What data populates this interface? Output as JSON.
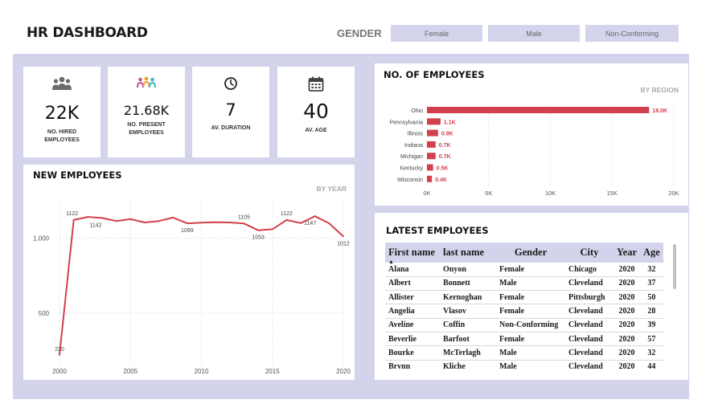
{
  "header": {
    "title": "HR DASHBOARD",
    "gender_label": "GENDER",
    "slicers": [
      "Female",
      "Male",
      "Non-Conforming"
    ]
  },
  "kpis": [
    {
      "icon": "people-group-icon",
      "value": "22K",
      "label_line1": "NO. HIRED",
      "label_line2": "EMPLOYEES"
    },
    {
      "icon": "colored-people-icon",
      "value": "21.68K",
      "label_line1": "NO. PRESENT",
      "label_line2": "EMPLOYEES"
    },
    {
      "icon": "clock-icon",
      "value": "7",
      "label_line1": "AV. DURATION",
      "label_line2": ""
    },
    {
      "icon": "calendar-icon",
      "value": "40",
      "label_line1": "AV. AGE",
      "label_line2": ""
    }
  ],
  "colors": {
    "accent": "#d1404c",
    "panel": "#d3d3ec",
    "icon_gray": "#6b6b6b"
  },
  "new_employees": {
    "title": "NEW EMPLOYEES",
    "subtitle": "BY YEAR",
    "chart_data": {
      "type": "line",
      "x": [
        2000,
        2001,
        2002,
        2003,
        2004,
        2005,
        2006,
        2007,
        2008,
        2009,
        2010,
        2011,
        2012,
        2013,
        2014,
        2015,
        2016,
        2017,
        2018,
        2019,
        2020
      ],
      "values": [
        220,
        1122,
        1142,
        1135,
        1115,
        1127,
        1105,
        1115,
        1138,
        1099,
        1104,
        1106,
        1105,
        1098,
        1053,
        1060,
        1122,
        1101,
        1147,
        1100,
        1012
      ],
      "point_labels": {
        "2000": "220",
        "2001": "1122",
        "2003": "1142",
        "2009": "1099",
        "2013": "1105",
        "2014": "1053",
        "2016": "1122",
        "2018": "1147",
        "2020": "1012"
      },
      "xticks": [
        "2000",
        "2005",
        "2010",
        "2015",
        "2020"
      ],
      "yticks": [
        "500",
        "1,000"
      ],
      "ylim": [
        150,
        1250
      ],
      "grid": true
    }
  },
  "by_region": {
    "title": "NO. OF EMPLOYEES",
    "subtitle": "BY REGION",
    "chart_data": {
      "type": "bar",
      "orientation": "horizontal",
      "categories": [
        "Ohio",
        "Pennsylvania",
        "Illinois",
        "Indiana",
        "Michigan",
        "Kentucky",
        "Wisconsin"
      ],
      "values": [
        18000,
        1100,
        900,
        700,
        700,
        500,
        400
      ],
      "data_labels": [
        "18.0K",
        "1.1K",
        "0.9K",
        "0.7K",
        "0.7K",
        "0.5K",
        "0.4K"
      ],
      "xticks": [
        "0K",
        "5K",
        "10K",
        "15K",
        "20K"
      ],
      "xlim": [
        0,
        20000
      ],
      "grid": true
    }
  },
  "latest": {
    "title": "LATEST EMPLOYEES",
    "columns": [
      "First name",
      "last name",
      "Gender",
      "City",
      "Year",
      "Age"
    ],
    "rows": [
      [
        "Alana",
        "Onyon",
        "Female",
        "Chicago",
        "2020",
        "32"
      ],
      [
        "Albert",
        "Bonnett",
        "Male",
        "Cleveland",
        "2020",
        "37"
      ],
      [
        "Allister",
        "Kernoghan",
        "Female",
        "Pittsburgh",
        "2020",
        "50"
      ],
      [
        "Angelia",
        "Vlasov",
        "Female",
        "Cleveland",
        "2020",
        "28"
      ],
      [
        "Aveline",
        "Coffin",
        "Non-Conforming",
        "Cleveland",
        "2020",
        "39"
      ],
      [
        "Beverlie",
        "Barfoot",
        "Female",
        "Cleveland",
        "2020",
        "57"
      ],
      [
        "Bourke",
        "McTerlagh",
        "Male",
        "Cleveland",
        "2020",
        "32"
      ],
      [
        "Brynn",
        "Kliche",
        "Male",
        "Cleveland",
        "2020",
        "44"
      ]
    ]
  }
}
